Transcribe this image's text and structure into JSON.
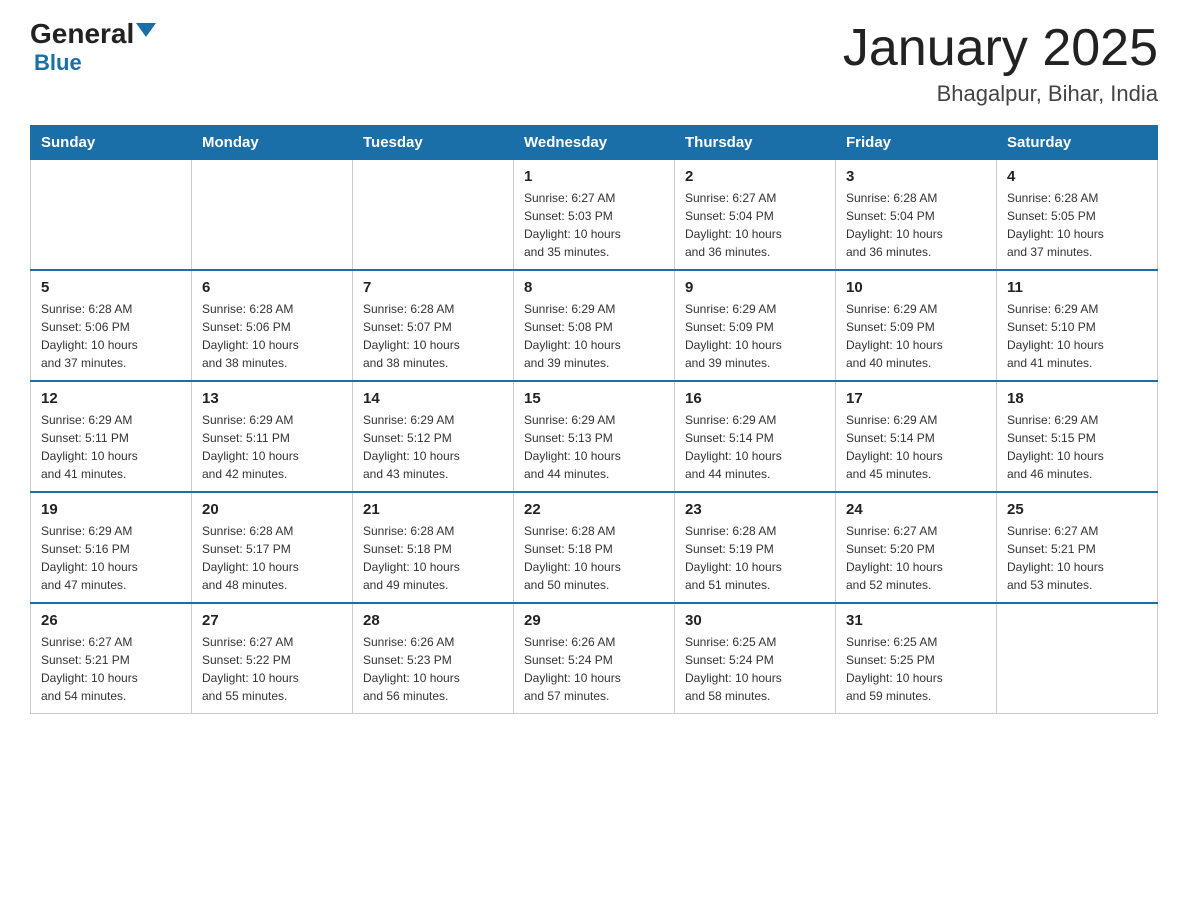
{
  "logo": {
    "general": "General",
    "blue": "Blue"
  },
  "title": "January 2025",
  "subtitle": "Bhagalpur, Bihar, India",
  "days_of_week": [
    "Sunday",
    "Monday",
    "Tuesday",
    "Wednesday",
    "Thursday",
    "Friday",
    "Saturday"
  ],
  "weeks": [
    [
      {
        "day": "",
        "info": ""
      },
      {
        "day": "",
        "info": ""
      },
      {
        "day": "",
        "info": ""
      },
      {
        "day": "1",
        "info": "Sunrise: 6:27 AM\nSunset: 5:03 PM\nDaylight: 10 hours\nand 35 minutes."
      },
      {
        "day": "2",
        "info": "Sunrise: 6:27 AM\nSunset: 5:04 PM\nDaylight: 10 hours\nand 36 minutes."
      },
      {
        "day": "3",
        "info": "Sunrise: 6:28 AM\nSunset: 5:04 PM\nDaylight: 10 hours\nand 36 minutes."
      },
      {
        "day": "4",
        "info": "Sunrise: 6:28 AM\nSunset: 5:05 PM\nDaylight: 10 hours\nand 37 minutes."
      }
    ],
    [
      {
        "day": "5",
        "info": "Sunrise: 6:28 AM\nSunset: 5:06 PM\nDaylight: 10 hours\nand 37 minutes."
      },
      {
        "day": "6",
        "info": "Sunrise: 6:28 AM\nSunset: 5:06 PM\nDaylight: 10 hours\nand 38 minutes."
      },
      {
        "day": "7",
        "info": "Sunrise: 6:28 AM\nSunset: 5:07 PM\nDaylight: 10 hours\nand 38 minutes."
      },
      {
        "day": "8",
        "info": "Sunrise: 6:29 AM\nSunset: 5:08 PM\nDaylight: 10 hours\nand 39 minutes."
      },
      {
        "day": "9",
        "info": "Sunrise: 6:29 AM\nSunset: 5:09 PM\nDaylight: 10 hours\nand 39 minutes."
      },
      {
        "day": "10",
        "info": "Sunrise: 6:29 AM\nSunset: 5:09 PM\nDaylight: 10 hours\nand 40 minutes."
      },
      {
        "day": "11",
        "info": "Sunrise: 6:29 AM\nSunset: 5:10 PM\nDaylight: 10 hours\nand 41 minutes."
      }
    ],
    [
      {
        "day": "12",
        "info": "Sunrise: 6:29 AM\nSunset: 5:11 PM\nDaylight: 10 hours\nand 41 minutes."
      },
      {
        "day": "13",
        "info": "Sunrise: 6:29 AM\nSunset: 5:11 PM\nDaylight: 10 hours\nand 42 minutes."
      },
      {
        "day": "14",
        "info": "Sunrise: 6:29 AM\nSunset: 5:12 PM\nDaylight: 10 hours\nand 43 minutes."
      },
      {
        "day": "15",
        "info": "Sunrise: 6:29 AM\nSunset: 5:13 PM\nDaylight: 10 hours\nand 44 minutes."
      },
      {
        "day": "16",
        "info": "Sunrise: 6:29 AM\nSunset: 5:14 PM\nDaylight: 10 hours\nand 44 minutes."
      },
      {
        "day": "17",
        "info": "Sunrise: 6:29 AM\nSunset: 5:14 PM\nDaylight: 10 hours\nand 45 minutes."
      },
      {
        "day": "18",
        "info": "Sunrise: 6:29 AM\nSunset: 5:15 PM\nDaylight: 10 hours\nand 46 minutes."
      }
    ],
    [
      {
        "day": "19",
        "info": "Sunrise: 6:29 AM\nSunset: 5:16 PM\nDaylight: 10 hours\nand 47 minutes."
      },
      {
        "day": "20",
        "info": "Sunrise: 6:28 AM\nSunset: 5:17 PM\nDaylight: 10 hours\nand 48 minutes."
      },
      {
        "day": "21",
        "info": "Sunrise: 6:28 AM\nSunset: 5:18 PM\nDaylight: 10 hours\nand 49 minutes."
      },
      {
        "day": "22",
        "info": "Sunrise: 6:28 AM\nSunset: 5:18 PM\nDaylight: 10 hours\nand 50 minutes."
      },
      {
        "day": "23",
        "info": "Sunrise: 6:28 AM\nSunset: 5:19 PM\nDaylight: 10 hours\nand 51 minutes."
      },
      {
        "day": "24",
        "info": "Sunrise: 6:27 AM\nSunset: 5:20 PM\nDaylight: 10 hours\nand 52 minutes."
      },
      {
        "day": "25",
        "info": "Sunrise: 6:27 AM\nSunset: 5:21 PM\nDaylight: 10 hours\nand 53 minutes."
      }
    ],
    [
      {
        "day": "26",
        "info": "Sunrise: 6:27 AM\nSunset: 5:21 PM\nDaylight: 10 hours\nand 54 minutes."
      },
      {
        "day": "27",
        "info": "Sunrise: 6:27 AM\nSunset: 5:22 PM\nDaylight: 10 hours\nand 55 minutes."
      },
      {
        "day": "28",
        "info": "Sunrise: 6:26 AM\nSunset: 5:23 PM\nDaylight: 10 hours\nand 56 minutes."
      },
      {
        "day": "29",
        "info": "Sunrise: 6:26 AM\nSunset: 5:24 PM\nDaylight: 10 hours\nand 57 minutes."
      },
      {
        "day": "30",
        "info": "Sunrise: 6:25 AM\nSunset: 5:24 PM\nDaylight: 10 hours\nand 58 minutes."
      },
      {
        "day": "31",
        "info": "Sunrise: 6:25 AM\nSunset: 5:25 PM\nDaylight: 10 hours\nand 59 minutes."
      },
      {
        "day": "",
        "info": ""
      }
    ]
  ]
}
